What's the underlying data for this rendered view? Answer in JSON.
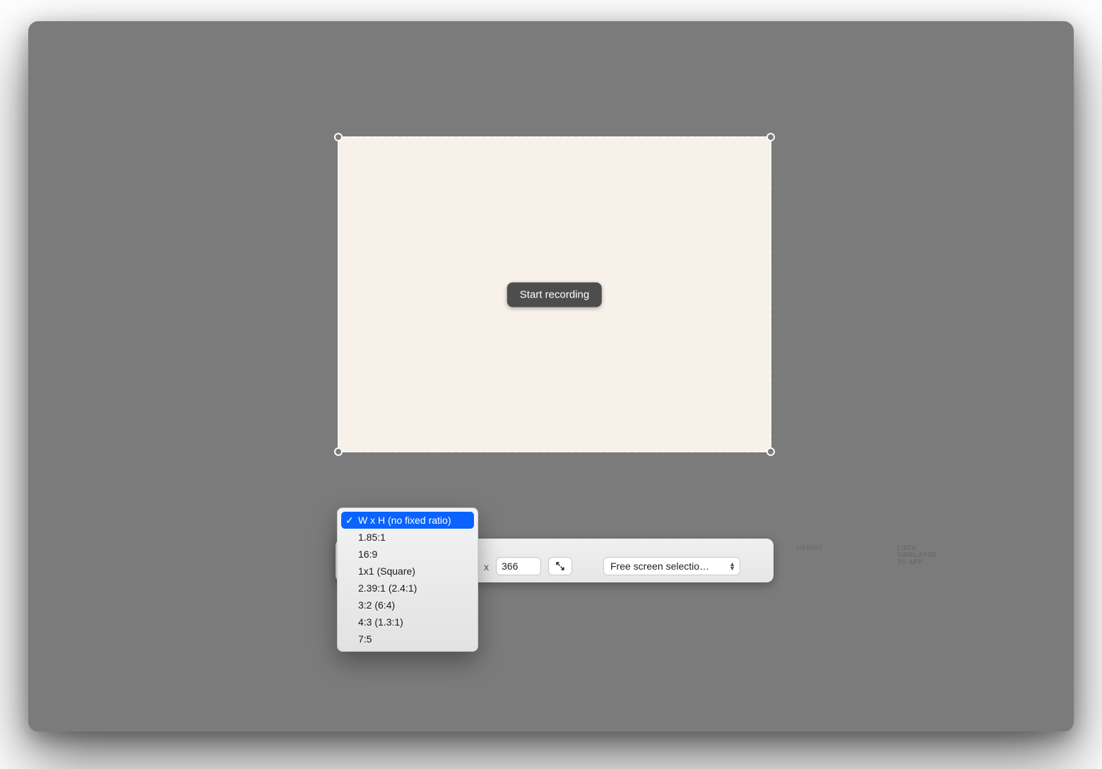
{
  "selection": {
    "start_label": "Start recording"
  },
  "bar": {
    "height_label": "HEIGHT",
    "height_value": "366",
    "x_sep": "x",
    "lock_label": "LOCK TIMELAPSE TO APP",
    "lock_value": "Free screen selectio…"
  },
  "ratio_menu": {
    "items": [
      "W x H (no fixed ratio)",
      "1.85:1",
      "16:9",
      "1x1 (Square)",
      "2.39:1 (2.4:1)",
      "3:2 (6:4)",
      "4:3 (1.3:1)",
      "7:5"
    ],
    "selected_index": 0
  }
}
